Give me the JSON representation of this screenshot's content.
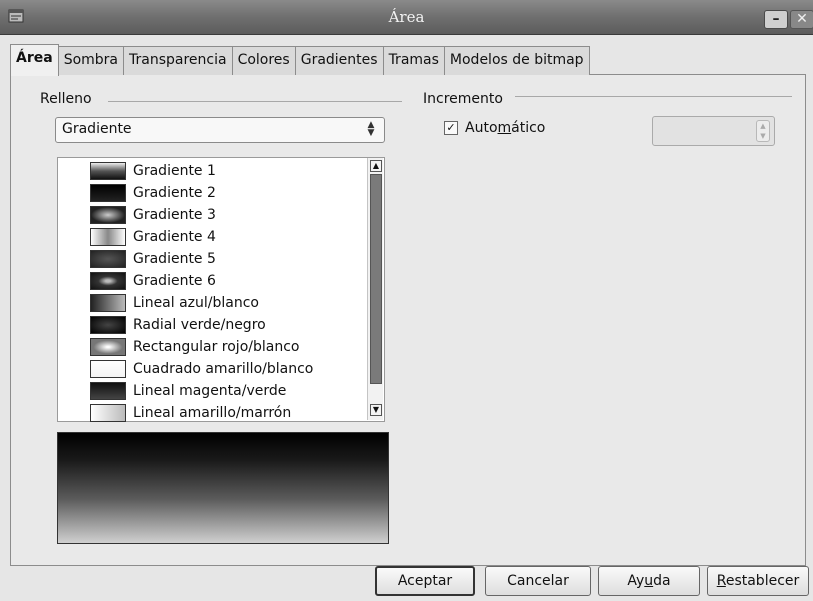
{
  "window": {
    "title": "Área",
    "minimize_symbol": "–",
    "close_symbol": "✕"
  },
  "tabs": [
    {
      "label": "Área"
    },
    {
      "label": "Sombra"
    },
    {
      "label": "Transparencia"
    },
    {
      "label": "Colores"
    },
    {
      "label": "Gradientes"
    },
    {
      "label": "Tramas"
    },
    {
      "label": "Modelos de bitmap"
    }
  ],
  "fill": {
    "group_label": "Relleno",
    "type_value": "Gradiente",
    "gradients": [
      {
        "label": "Gradiente 1"
      },
      {
        "label": "Gradiente 2"
      },
      {
        "label": "Gradiente 3"
      },
      {
        "label": "Gradiente 4"
      },
      {
        "label": "Gradiente 5"
      },
      {
        "label": "Gradiente 6"
      },
      {
        "label": "Lineal azul/blanco"
      },
      {
        "label": "Radial verde/negro"
      },
      {
        "label": "Rectangular rojo/blanco"
      },
      {
        "label": "Cuadrado amarillo/blanco"
      },
      {
        "label": "Lineal magenta/verde"
      },
      {
        "label": "Lineal amarillo/marrón"
      }
    ]
  },
  "increment": {
    "group_label": "Incremento",
    "auto_label_pre": "Auto",
    "auto_label_mnemonic": "m",
    "auto_label_post": "ático",
    "auto_checked": true,
    "check_symbol": "✓"
  },
  "buttons": {
    "ok": "Aceptar",
    "cancel": "Cancelar",
    "help_pre": "Ay",
    "help_mnemonic": "u",
    "help_post": "da",
    "reset_mnemonic": "R",
    "reset_post": "establecer"
  },
  "colors": {
    "titlebar": "#6f6f6f",
    "panel": "#e9e9e9"
  }
}
